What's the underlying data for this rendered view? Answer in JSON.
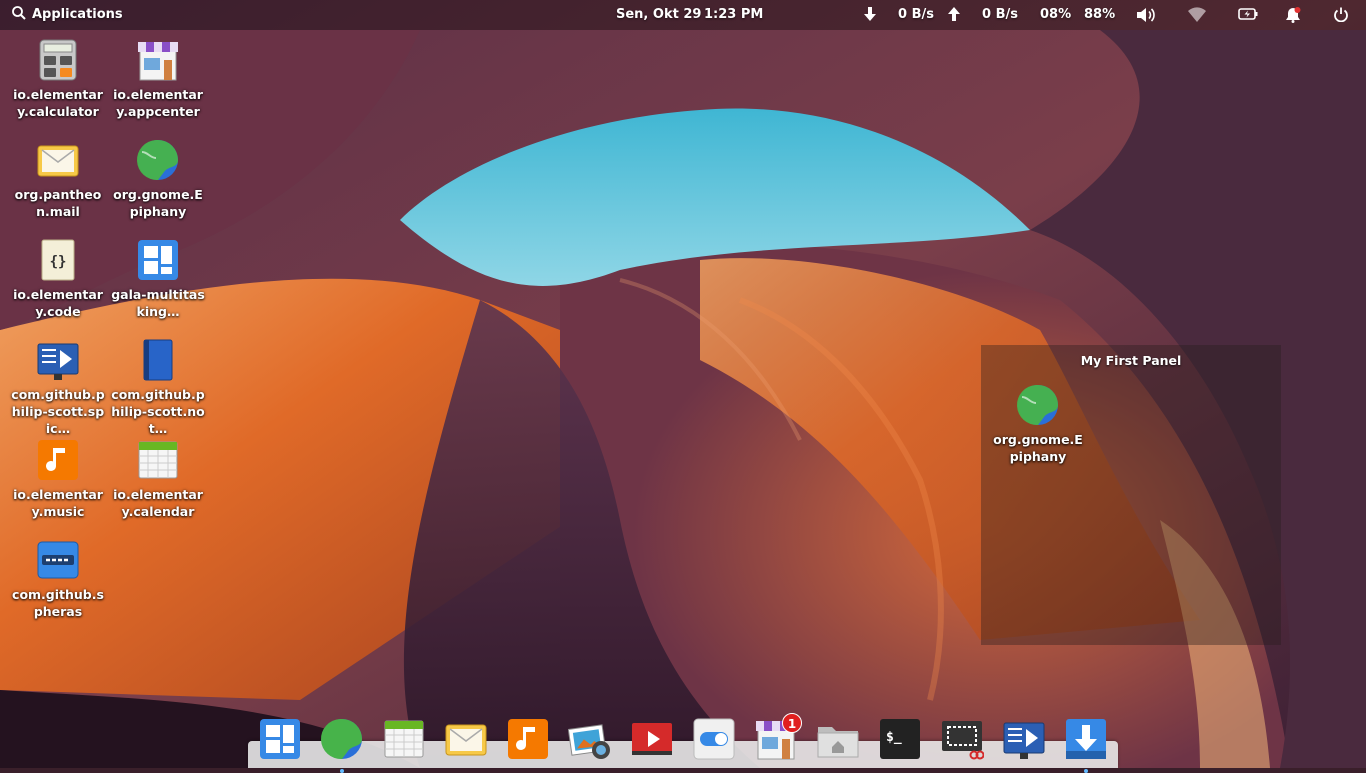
{
  "top_panel": {
    "applications_label": "Applications",
    "date": "Sen, Okt 29",
    "time": "1:23 PM",
    "download_speed": "0 B/s",
    "upload_speed": "0 B/s",
    "cpu": "08%",
    "memory": "88%"
  },
  "desktop_icons": [
    {
      "label": "io.elementary.calculator",
      "icon": "calculator-icon"
    },
    {
      "label": "io.elementary.appcenter",
      "icon": "appcenter-icon"
    },
    {
      "label": "org.pantheon.mail",
      "icon": "mail-icon"
    },
    {
      "label": "org.gnome.Epiphany",
      "icon": "epiphany-icon"
    },
    {
      "label": "io.elementary.code",
      "icon": "code-icon"
    },
    {
      "label": "gala-multitasking…",
      "icon": "multitasking-icon"
    },
    {
      "label": "com.github.philip-scott.spic…",
      "icon": "spice-up-icon"
    },
    {
      "label": "com.github.philip-scott.not…",
      "icon": "notes-up-icon"
    },
    {
      "label": "io.elementary.music",
      "icon": "music-icon"
    },
    {
      "label": "io.elementary.calendar",
      "icon": "calendar-icon"
    },
    {
      "label": "com.github.spheras",
      "icon": "desktopfolder-icon"
    }
  ],
  "panel": {
    "title": "My First Panel",
    "item_label": "org.gnome.Epiphany"
  },
  "dock": {
    "items": [
      {
        "name": "multitasking-view",
        "icon": "multitasking-icon",
        "running": false
      },
      {
        "name": "epiphany",
        "icon": "epiphany-icon",
        "running": true
      },
      {
        "name": "calendar",
        "icon": "calendar-icon",
        "running": false
      },
      {
        "name": "mail",
        "icon": "mail-icon",
        "running": false
      },
      {
        "name": "music",
        "icon": "music-icon",
        "running": false
      },
      {
        "name": "photos",
        "icon": "photos-icon",
        "running": false
      },
      {
        "name": "videos",
        "icon": "videos-icon",
        "running": false
      },
      {
        "name": "system-settings",
        "icon": "settings-icon",
        "running": false
      },
      {
        "name": "appcenter",
        "icon": "appcenter-icon",
        "running": false,
        "badge": "1"
      },
      {
        "name": "files",
        "icon": "files-icon",
        "running": false
      },
      {
        "name": "terminal",
        "icon": "terminal-icon",
        "running": false
      },
      {
        "name": "screenshot",
        "icon": "screenshot-icon",
        "running": false
      },
      {
        "name": "spice-up",
        "icon": "spice-up-icon",
        "running": false
      },
      {
        "name": "installer",
        "icon": "download-icon",
        "running": true
      }
    ]
  }
}
